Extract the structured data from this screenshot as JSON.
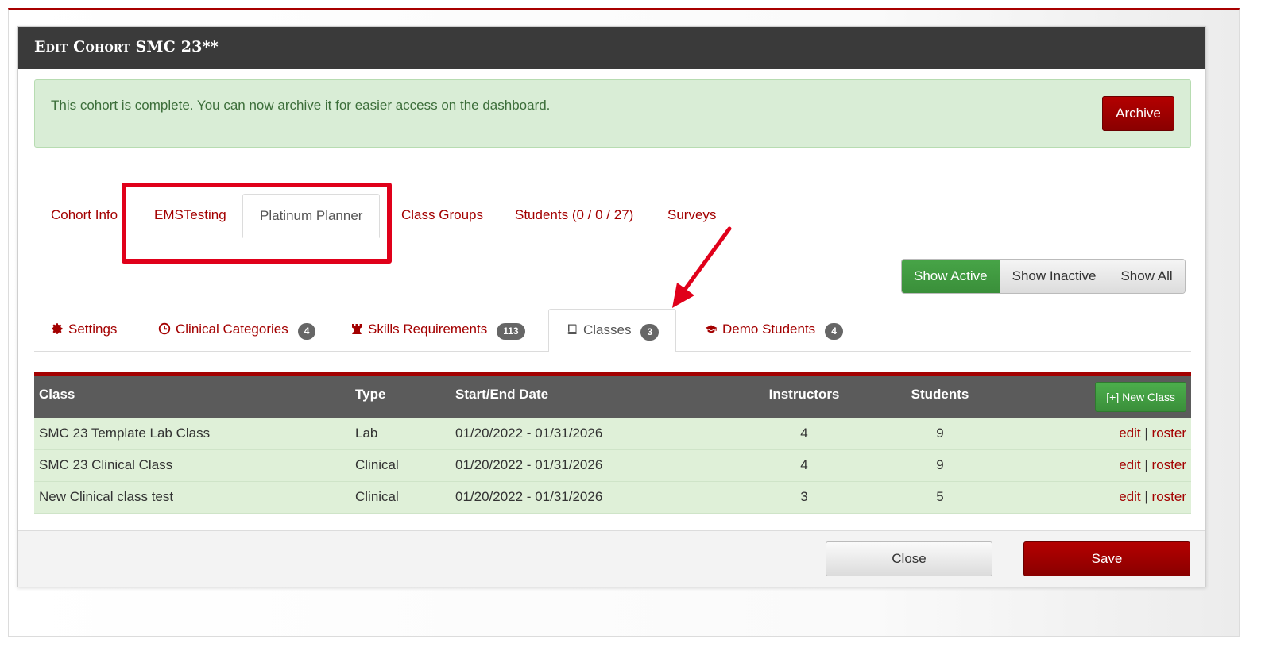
{
  "modal": {
    "title": "Edit Cohort SMC 23**"
  },
  "alert": {
    "message": "This cohort is complete. You can now archive it for easier access on the dashboard.",
    "archive_label": "Archive"
  },
  "main_tabs": [
    {
      "label": "Cohort Info"
    },
    {
      "label": "EMSTesting"
    },
    {
      "label": "Platinum Planner",
      "active": true
    },
    {
      "label": "Class Groups"
    },
    {
      "label": "Students (0 / 0 / 27)"
    },
    {
      "label": "Surveys"
    }
  ],
  "filters": {
    "show_active": "Show Active",
    "show_inactive": "Show Inactive",
    "show_all": "Show All"
  },
  "sub_tabs": [
    {
      "label": "Settings",
      "icon": "gear-icon"
    },
    {
      "label": "Clinical Categories",
      "icon": "clock-icon",
      "badge": "4"
    },
    {
      "label": "Skills Requirements",
      "icon": "rook-icon",
      "badge": "113"
    },
    {
      "label": "Classes",
      "icon": "book-icon",
      "badge": "3",
      "active": true
    },
    {
      "label": "Demo Students",
      "icon": "graduation-cap-icon",
      "badge": "4"
    }
  ],
  "table": {
    "headers": {
      "class": "Class",
      "type": "Type",
      "dates": "Start/End Date",
      "instructors": "Instructors",
      "students": "Students"
    },
    "new_class_label": "[+] New Class",
    "edit_label": "edit",
    "separator": "|",
    "roster_label": "roster",
    "rows": [
      {
        "class": "SMC 23 Template Lab Class",
        "type": "Lab",
        "dates": "01/20/2022 - 01/31/2026",
        "instructors": "4",
        "students": "9"
      },
      {
        "class": "SMC 23 Clinical Class",
        "type": "Clinical",
        "dates": "01/20/2022 - 01/31/2026",
        "instructors": "4",
        "students": "9"
      },
      {
        "class": "New Clinical class test",
        "type": "Clinical",
        "dates": "01/20/2022 - 01/31/2026",
        "instructors": "3",
        "students": "5"
      }
    ]
  },
  "footer": {
    "close_label": "Close",
    "save_label": "Save"
  },
  "colors": {
    "brand_red": "#a30000",
    "header_dark": "#3a3a3a",
    "success_green": "#47a447",
    "alert_bg": "#d9edd6",
    "annotation_red": "#e0001a"
  }
}
